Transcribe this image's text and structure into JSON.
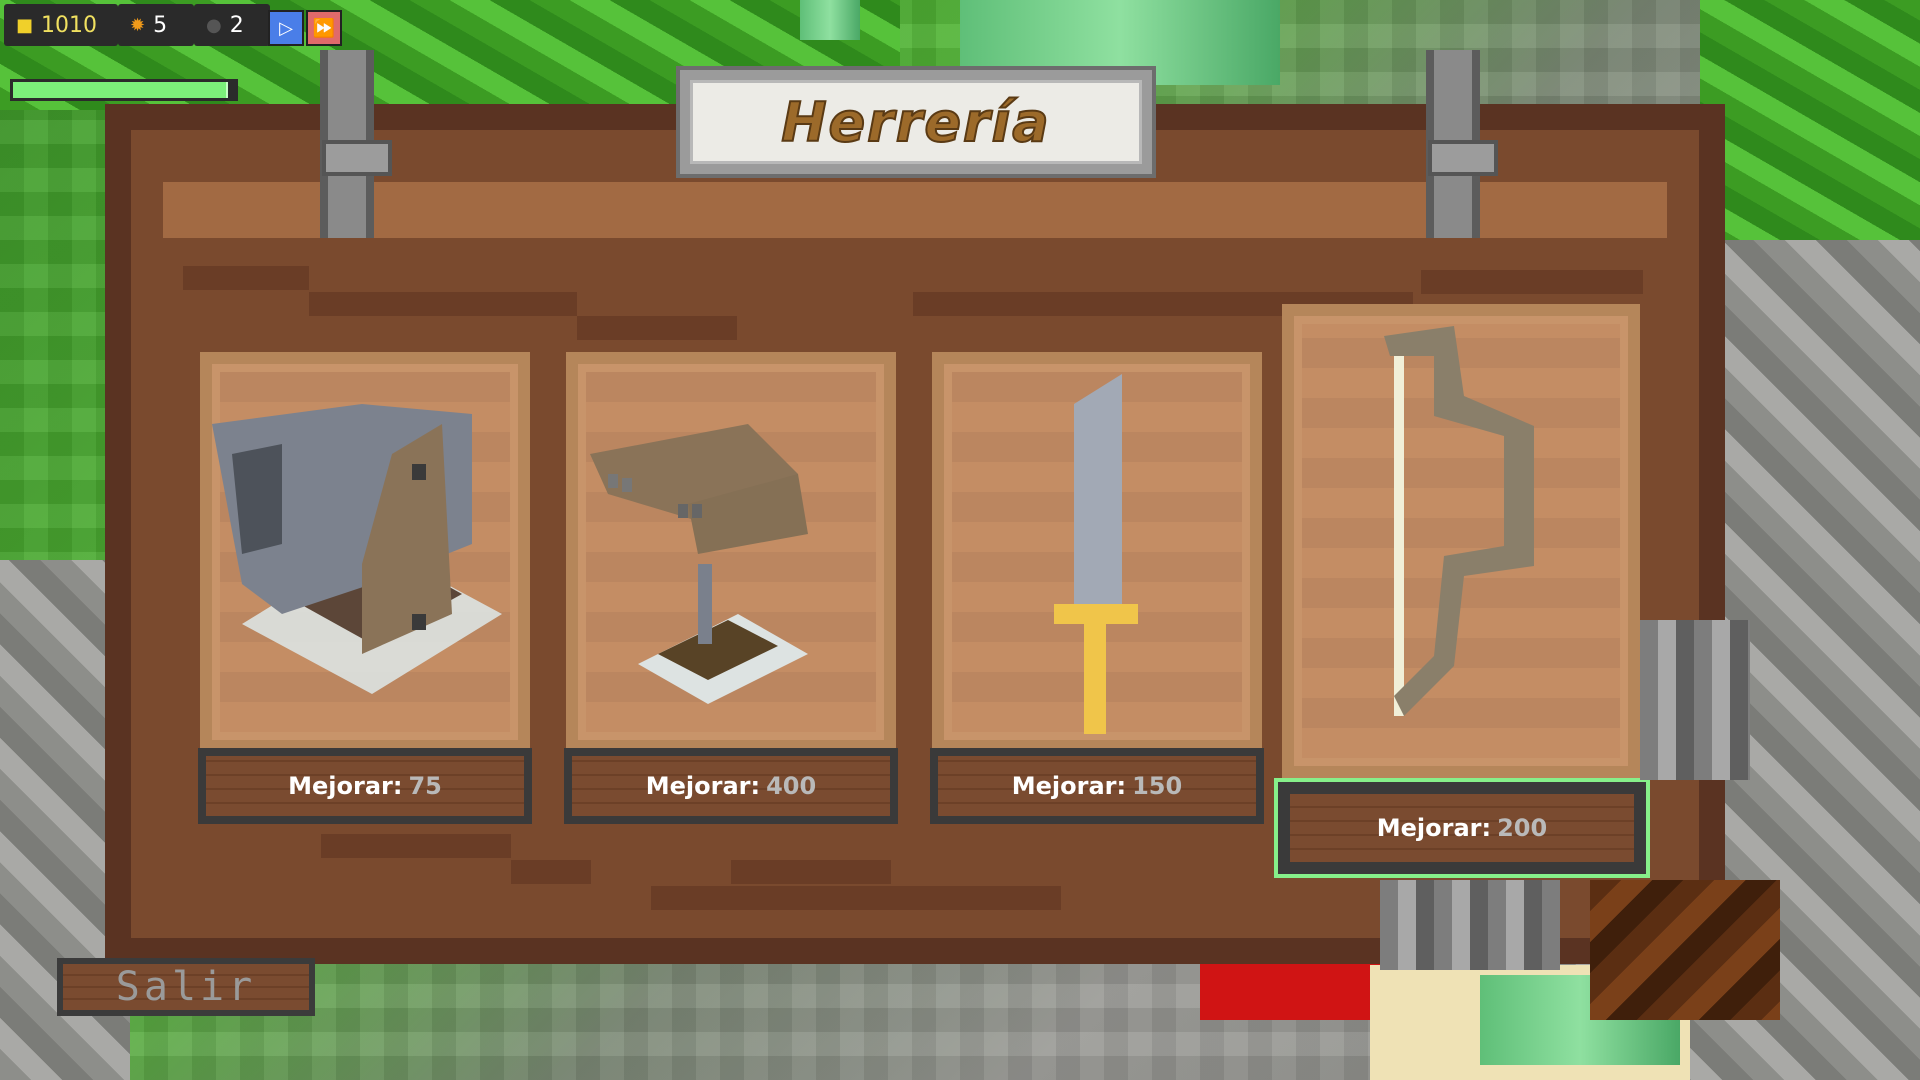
{
  "hud": {
    "gold": "1010",
    "lives": "5",
    "units": "2",
    "play_icon": "play-icon",
    "fast_forward_icon": "fast-forward-icon",
    "health_fraction": 0.96
  },
  "panel": {
    "title": "Herrería"
  },
  "items": [
    {
      "name": "Cañón",
      "icon": "cannon-icon",
      "label": "Mejorar:",
      "cost": "75",
      "selected": false
    },
    {
      "name": "Ballesta",
      "icon": "crossbow-icon",
      "label": "Mejorar:",
      "cost": "400",
      "selected": false
    },
    {
      "name": "Espada",
      "icon": "sword-icon",
      "label": "Mejorar:",
      "cost": "150",
      "selected": false
    },
    {
      "name": "Arco",
      "icon": "bow-icon",
      "label": "Mejorar:",
      "cost": "200",
      "selected": true
    }
  ],
  "exit_label": "Salir",
  "colors": {
    "selection": "#86f08a",
    "panel_wood": "#5a3322",
    "title_text": "#9c6a2a"
  }
}
